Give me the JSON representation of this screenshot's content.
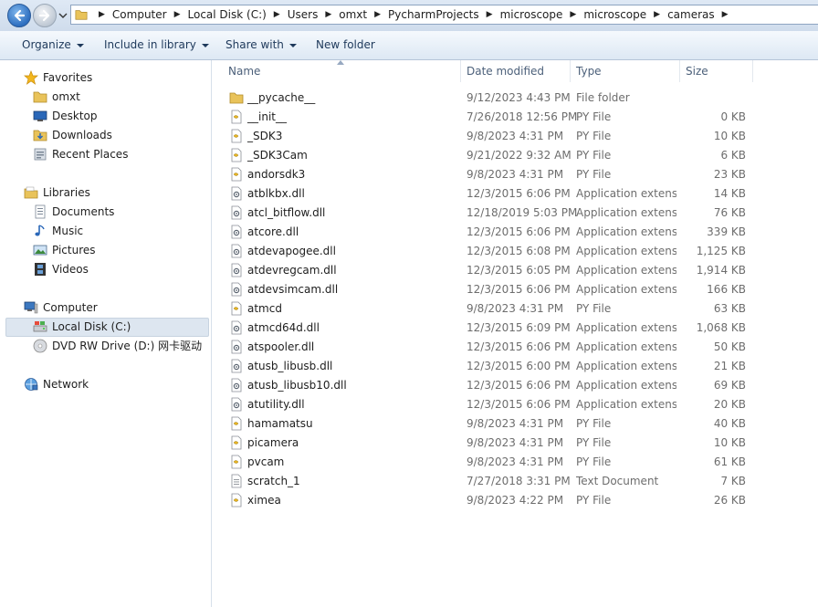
{
  "address_bar": {
    "breadcrumbs": [
      "Computer",
      "Local Disk (C:)",
      "Users",
      "omxt",
      "PycharmProjects",
      "microscope",
      "microscope",
      "cameras"
    ]
  },
  "toolbar": {
    "organize": "Organize",
    "include_in_library": "Include in library",
    "share_with": "Share with",
    "new_folder": "New folder"
  },
  "nav": {
    "favorites": {
      "label": "Favorites",
      "items": [
        "omxt",
        "Desktop",
        "Downloads",
        "Recent Places"
      ]
    },
    "libraries": {
      "label": "Libraries",
      "items": [
        "Documents",
        "Music",
        "Pictures",
        "Videos"
      ]
    },
    "computer": {
      "label": "Computer",
      "items": [
        "Local Disk (C:)",
        "DVD RW Drive (D:) 网卡驱动"
      ],
      "selected": "Local Disk (C:)"
    },
    "network": {
      "label": "Network"
    }
  },
  "columns": {
    "name": "Name",
    "date": "Date modified",
    "type": "Type",
    "size": "Size"
  },
  "files": [
    {
      "name": "__pycache__",
      "date": "9/12/2023 4:43 PM",
      "type": "File folder",
      "size": "",
      "icon": "folder-icon"
    },
    {
      "name": "__init__",
      "date": "7/26/2018 12:56 PM",
      "type": "PY File",
      "size": "0 KB",
      "icon": "py-file-icon"
    },
    {
      "name": "_SDK3",
      "date": "9/8/2023 4:31 PM",
      "type": "PY File",
      "size": "10 KB",
      "icon": "py-file-icon"
    },
    {
      "name": "_SDK3Cam",
      "date": "9/21/2022 9:32 AM",
      "type": "PY File",
      "size": "6 KB",
      "icon": "py-file-icon"
    },
    {
      "name": "andorsdk3",
      "date": "9/8/2023 4:31 PM",
      "type": "PY File",
      "size": "23 KB",
      "icon": "py-file-icon"
    },
    {
      "name": "atblkbx.dll",
      "date": "12/3/2015 6:06 PM",
      "type": "Application extens...",
      "size": "14 KB",
      "icon": "dll-file-icon"
    },
    {
      "name": "atcl_bitflow.dll",
      "date": "12/18/2019 5:03 PM",
      "type": "Application extens...",
      "size": "76 KB",
      "icon": "dll-file-icon"
    },
    {
      "name": "atcore.dll",
      "date": "12/3/2015 6:06 PM",
      "type": "Application extens...",
      "size": "339 KB",
      "icon": "dll-file-icon"
    },
    {
      "name": "atdevapogee.dll",
      "date": "12/3/2015 6:08 PM",
      "type": "Application extens...",
      "size": "1,125 KB",
      "icon": "dll-file-icon"
    },
    {
      "name": "atdevregcam.dll",
      "date": "12/3/2015 6:05 PM",
      "type": "Application extens...",
      "size": "1,914 KB",
      "icon": "dll-file-icon"
    },
    {
      "name": "atdevsimcam.dll",
      "date": "12/3/2015 6:06 PM",
      "type": "Application extens...",
      "size": "166 KB",
      "icon": "dll-file-icon"
    },
    {
      "name": "atmcd",
      "date": "9/8/2023 4:31 PM",
      "type": "PY File",
      "size": "63 KB",
      "icon": "py-file-icon"
    },
    {
      "name": "atmcd64d.dll",
      "date": "12/3/2015 6:09 PM",
      "type": "Application extens...",
      "size": "1,068 KB",
      "icon": "dll-file-icon"
    },
    {
      "name": "atspooler.dll",
      "date": "12/3/2015 6:06 PM",
      "type": "Application extens...",
      "size": "50 KB",
      "icon": "dll-file-icon"
    },
    {
      "name": "atusb_libusb.dll",
      "date": "12/3/2015 6:00 PM",
      "type": "Application extens...",
      "size": "21 KB",
      "icon": "dll-file-icon"
    },
    {
      "name": "atusb_libusb10.dll",
      "date": "12/3/2015 6:06 PM",
      "type": "Application extens...",
      "size": "69 KB",
      "icon": "dll-file-icon"
    },
    {
      "name": "atutility.dll",
      "date": "12/3/2015 6:06 PM",
      "type": "Application extens...",
      "size": "20 KB",
      "icon": "dll-file-icon"
    },
    {
      "name": "hamamatsu",
      "date": "9/8/2023 4:31 PM",
      "type": "PY File",
      "size": "40 KB",
      "icon": "py-file-icon"
    },
    {
      "name": "picamera",
      "date": "9/8/2023 4:31 PM",
      "type": "PY File",
      "size": "10 KB",
      "icon": "py-file-icon"
    },
    {
      "name": "pvcam",
      "date": "9/8/2023 4:31 PM",
      "type": "PY File",
      "size": "61 KB",
      "icon": "py-file-icon"
    },
    {
      "name": "scratch_1",
      "date": "7/27/2018 3:31 PM",
      "type": "Text Document",
      "size": "7 KB",
      "icon": "text-file-icon"
    },
    {
      "name": "ximea",
      "date": "9/8/2023 4:22 PM",
      "type": "PY File",
      "size": "26 KB",
      "icon": "py-file-icon"
    }
  ]
}
